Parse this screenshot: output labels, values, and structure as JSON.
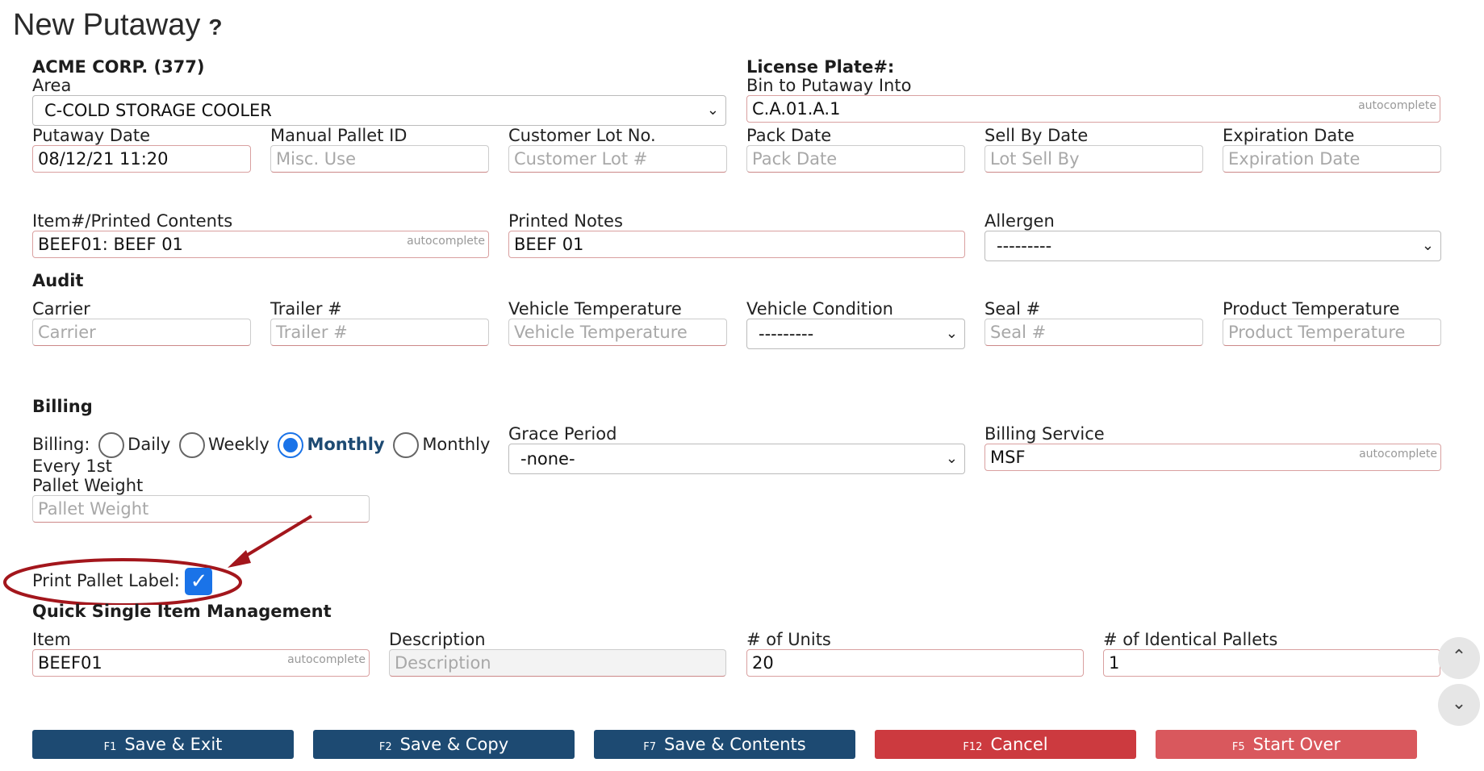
{
  "title": "New Putaway",
  "help": "?",
  "customer": "ACME CORP. (377)",
  "license_plate_label": "License Plate#:",
  "area": {
    "label": "Area",
    "value": "C-COLD STORAGE COOLER"
  },
  "bin": {
    "label": "Bin to Putaway Into",
    "value": "C.A.01.A.1",
    "hint": "autocomplete"
  },
  "putaway_date": {
    "label": "Putaway Date",
    "value": "08/12/21 11:20"
  },
  "manual_pallet": {
    "label": "Manual Pallet ID",
    "placeholder": "Misc. Use"
  },
  "customer_lot": {
    "label": "Customer Lot No.",
    "placeholder": "Customer Lot #"
  },
  "pack_date": {
    "label": "Pack Date",
    "placeholder": "Pack Date"
  },
  "sell_by": {
    "label": "Sell By Date",
    "placeholder": "Lot Sell By"
  },
  "expiration": {
    "label": "Expiration Date",
    "placeholder": "Expiration Date"
  },
  "item_printed": {
    "label": "Item#/Printed Contents",
    "value": "BEEF01: BEEF 01",
    "hint": "autocomplete"
  },
  "printed_notes": {
    "label": "Printed Notes",
    "value": "BEEF 01"
  },
  "allergen": {
    "label": "Allergen",
    "value": "---------"
  },
  "audit": {
    "heading": "Audit",
    "carrier": {
      "label": "Carrier",
      "placeholder": "Carrier"
    },
    "trailer": {
      "label": "Trailer #",
      "placeholder": "Trailer #"
    },
    "vehicle_temp": {
      "label": "Vehicle Temperature",
      "placeholder": "Vehicle Temperature"
    },
    "vehicle_cond": {
      "label": "Vehicle Condition",
      "value": "---------"
    },
    "seal": {
      "label": "Seal #",
      "placeholder": "Seal #"
    },
    "product_temp": {
      "label": "Product Temperature",
      "placeholder": "Product Temperature"
    }
  },
  "billing": {
    "heading": "Billing",
    "label": "Billing:",
    "options": [
      "Daily",
      "Weekly",
      "Monthly",
      "Monthly"
    ],
    "selected": "Monthly",
    "every": "Every 1st",
    "grace": {
      "label": "Grace Period",
      "value": "-none-"
    },
    "service": {
      "label": "Billing Service",
      "value": "MSF",
      "hint": "autocomplete"
    },
    "pallet_weight": {
      "label": "Pallet Weight",
      "placeholder": "Pallet Weight"
    }
  },
  "print_label": {
    "label": "Print Pallet Label:",
    "checked": true
  },
  "quick": {
    "heading": "Quick Single Item Management",
    "item": {
      "label": "Item",
      "value": "BEEF01",
      "hint": "autocomplete"
    },
    "description": {
      "label": "Description",
      "placeholder": "Description"
    },
    "units": {
      "label": "# of Units",
      "value": "20"
    },
    "pallets": {
      "label": "# of Identical Pallets",
      "value": "1"
    }
  },
  "buttons": [
    {
      "key": "F1",
      "label": "Save & Exit"
    },
    {
      "key": "F2",
      "label": "Save & Copy"
    },
    {
      "key": "F7",
      "label": "Save & Contents"
    },
    {
      "key": "F12",
      "label": "Cancel"
    },
    {
      "key": "F5",
      "label": "Start Over"
    }
  ],
  "colors": {
    "primary": "#1d4a72",
    "danger": "#cc3a3f",
    "danger_light": "#d9585d",
    "accent": "#1a73e8",
    "annotation": "#a3161c"
  }
}
